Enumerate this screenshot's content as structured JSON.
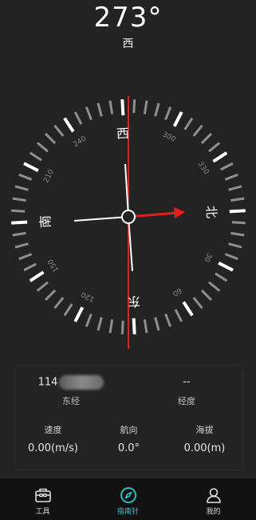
{
  "heading": {
    "degrees": "273°",
    "direction": "西"
  },
  "compass": {
    "heading_value": 273,
    "cardinals": {
      "north": "北",
      "east": "东",
      "south": "南",
      "west": "西"
    },
    "degree_labels": [
      "30",
      "60",
      "120",
      "150",
      "210",
      "240",
      "300",
      "330"
    ],
    "colors": {
      "accent": "#e81e1e",
      "ring": "#9a9a9a",
      "major_tick": "#ffffff"
    }
  },
  "location": {
    "longitude_value": "114",
    "longitude_label": "东经",
    "latitude_value": "--",
    "latitude_label": "经度"
  },
  "stats": {
    "speed_label": "速度",
    "speed_value": "0.00(m/s)",
    "course_label": "航向",
    "course_value": "0.0°",
    "altitude_label": "海拔",
    "altitude_value": "0.00(m)"
  },
  "nav": {
    "tools_label": "工具",
    "compass_label": "指南针",
    "mine_label": "我的",
    "active": "compass",
    "active_color": "#22d3d3"
  }
}
